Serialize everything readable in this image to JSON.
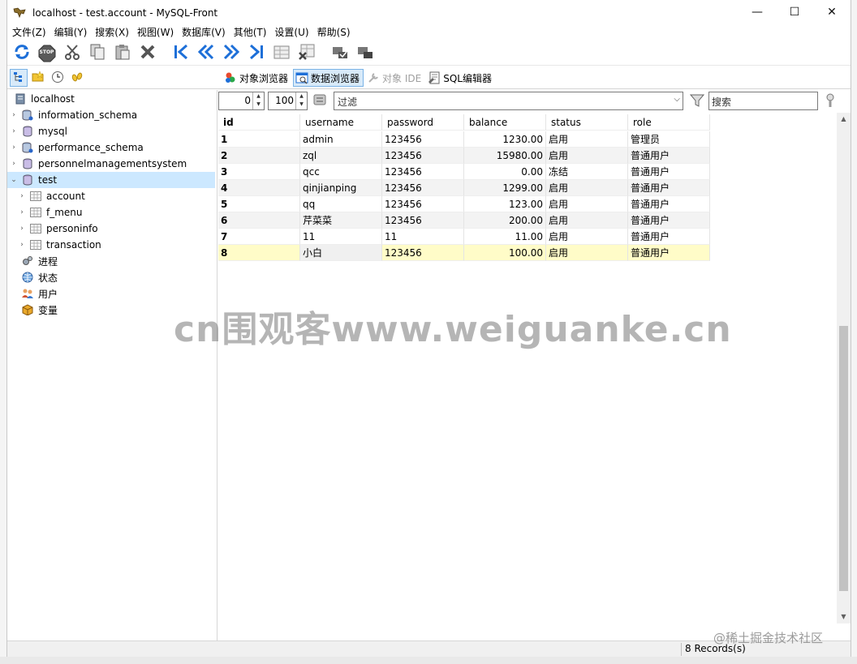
{
  "window": {
    "title": "localhost - test.account - MySQL-Front",
    "minimize": "—",
    "maximize": "☐",
    "close": "✕"
  },
  "menu": [
    "文件(Z)",
    "编辑(Y)",
    "搜索(X)",
    "视图(W)",
    "数据库(V)",
    "其他(T)",
    "设置(U)",
    "帮助(S)"
  ],
  "toolbar": {
    "stop": "STOP",
    "icons": [
      "refresh-icon",
      "stop-icon",
      "cut-icon",
      "copy-icon",
      "paste-icon",
      "delete-icon",
      "first-icon",
      "prev-icon",
      "next-icon",
      "last-icon",
      "insert-record-icon",
      "delete-record-icon",
      "post-icon",
      "cancel-icon"
    ]
  },
  "tabs": [
    {
      "label": "对象浏览器",
      "state": "normal"
    },
    {
      "label": "数据浏览器",
      "state": "active"
    },
    {
      "label": "对象 IDE",
      "state": "disabled"
    },
    {
      "label": "SQL编辑器",
      "state": "normal"
    }
  ],
  "tree": {
    "root": "localhost",
    "databases": [
      "information_schema",
      "mysql",
      "performance_schema",
      "personnelmanagementsystem",
      "test"
    ],
    "tables": [
      "account",
      "f_menu",
      "personinfo",
      "transaction"
    ],
    "extras": [
      "进程",
      "状态",
      "用户",
      "变量"
    ]
  },
  "filter": {
    "offset": "0",
    "limit": "100",
    "filter_placeholder": "过滤",
    "search_placeholder": "搜索"
  },
  "grid": {
    "columns": [
      "id",
      "username",
      "password",
      "balance",
      "status",
      "role"
    ],
    "rows": [
      [
        "1",
        "admin",
        "123456",
        "1230.00",
        "启用",
        "管理员"
      ],
      [
        "2",
        "zql",
        "123456",
        "15980.00",
        "启用",
        "普通用户"
      ],
      [
        "3",
        "qcc",
        "123456",
        "0.00",
        "冻结",
        "普通用户"
      ],
      [
        "4",
        "qinjianping",
        "123456",
        "1299.00",
        "启用",
        "普通用户"
      ],
      [
        "5",
        "qq",
        "123456",
        "123.00",
        "启用",
        "普通用户"
      ],
      [
        "6",
        "芹菜菜",
        "123456",
        "200.00",
        "启用",
        "普通用户"
      ],
      [
        "7",
        "11",
        "11",
        "11.00",
        "启用",
        "普通用户"
      ],
      [
        "8",
        "小白",
        "123456",
        "100.00",
        "启用",
        "普通用户"
      ]
    ]
  },
  "status": {
    "records": "8 Records(s)"
  },
  "watermark": "cn围观客www.weiguanke.cn",
  "watermark2": "@稀土掘金技术社区"
}
